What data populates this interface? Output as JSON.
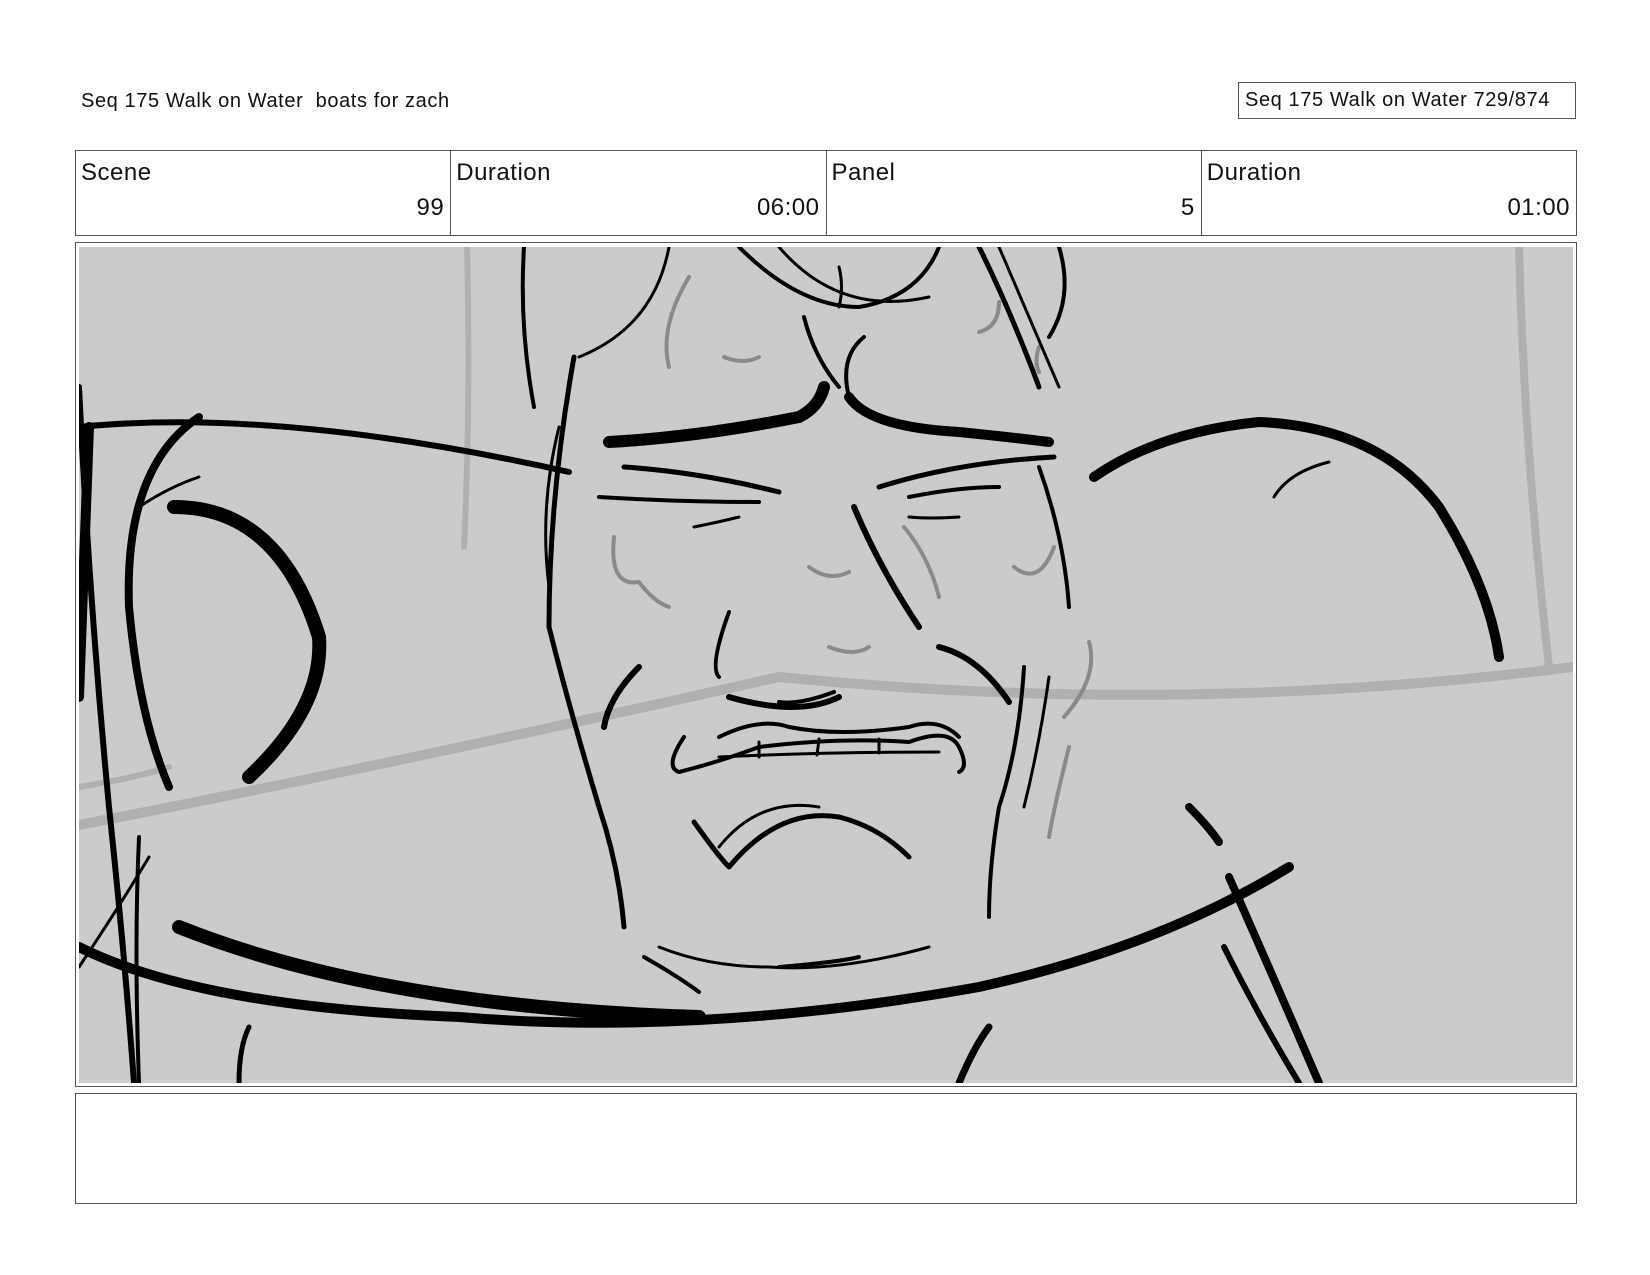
{
  "header": {
    "left_title": "Seq 175 Walk on Water  boats for zach",
    "right_title": "Seq 175 Walk on Water 729/874"
  },
  "info": {
    "scene_label": "Scene",
    "scene_value": "99",
    "scene_duration_label": "Duration",
    "scene_duration_value": "06:00",
    "panel_label": "Panel",
    "panel_value": "5",
    "panel_duration_label": "Duration",
    "panel_duration_value": "01:00"
  },
  "panel": {
    "background_color": "#cbcbcb",
    "ink_color": "#000000",
    "shading_color": "#8a8a8a"
  },
  "notes": {
    "text": ""
  }
}
